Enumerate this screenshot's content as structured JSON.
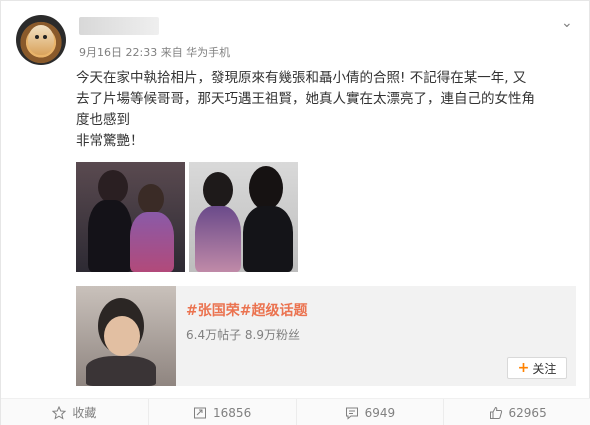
{
  "post": {
    "meta": "9月16日 22:33 来自 华为手机",
    "text_lines": [
      "今天在家中執拾相片，發現原來有幾張和聶小倩的合照! 不記得在某一年, 又",
      "去了片場等候哥哥，那天巧遇王祖賢，她真人實在太漂亮了，連自己的女性角",
      "度也感到",
      "非常驚艷！"
    ]
  },
  "topic": {
    "title": "#张国荣#超级话题",
    "stats": "6.4万帖子 8.9万粉丝",
    "follow_label": "关注"
  },
  "actions": {
    "favorite_label": "收藏",
    "repost_count": "16856",
    "comment_count": "6949",
    "like_count": "62965"
  },
  "icons": {
    "chevron": "chevron-down-icon",
    "favorite": "star-icon",
    "repost": "repost-icon",
    "comment": "comment-icon",
    "like": "thumbs-up-icon",
    "follow": "plus-icon"
  },
  "colors": {
    "accent": "#eb7350",
    "follow_plus": "#ff8200",
    "meta_gray": "#808080"
  }
}
